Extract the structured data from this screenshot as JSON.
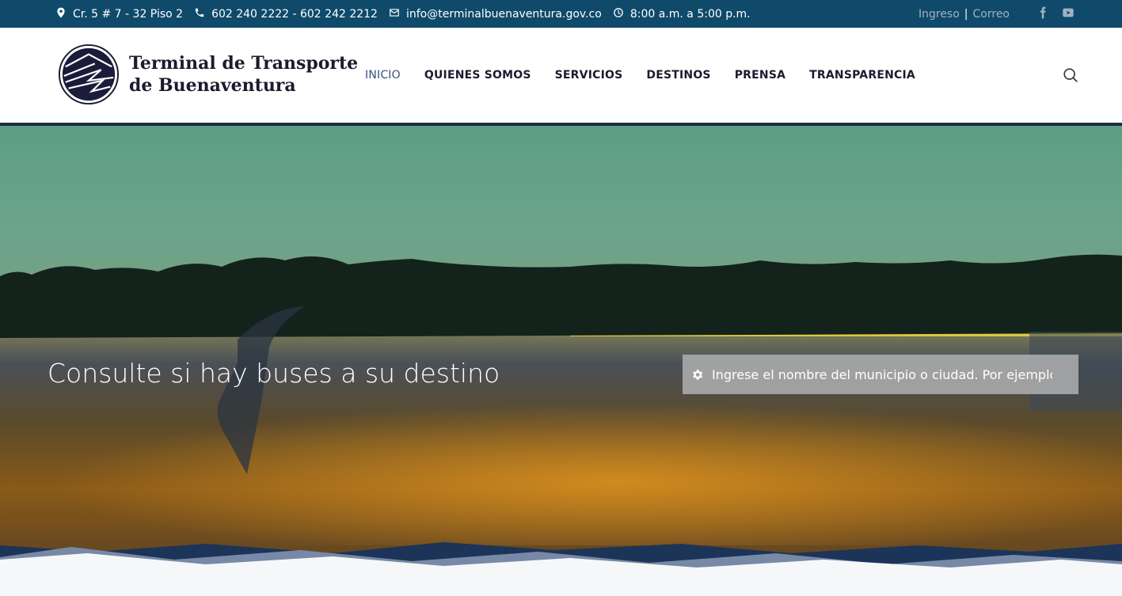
{
  "topbar": {
    "address": "Cr. 5 # 7 - 32 Piso 2",
    "phones": "602 240 2222 - 602 242 2212",
    "email": "info@terminalbuenaventura.gov.co",
    "hours": "8:00 a.m. a 5:00 p.m.",
    "login": "Ingreso",
    "separator": "|",
    "mail": "Correo"
  },
  "logo": {
    "line1": "Terminal de Transporte",
    "line2": "de Buenaventura"
  },
  "nav": {
    "items": [
      "INICIO",
      "QUIENES SOMOS",
      "SERVICIOS",
      "DESTINOS",
      "PRENSA",
      "TRANSPARENCIA"
    ]
  },
  "hero": {
    "title": "Consulte si hay buses a su destino",
    "search_placeholder": "Ingrese el nombre del municipio o ciudad. Por ejemplo"
  },
  "colors": {
    "topbar": "#0f4a6b",
    "accent": "#3a4f7e",
    "navy": "#1c2e44"
  }
}
